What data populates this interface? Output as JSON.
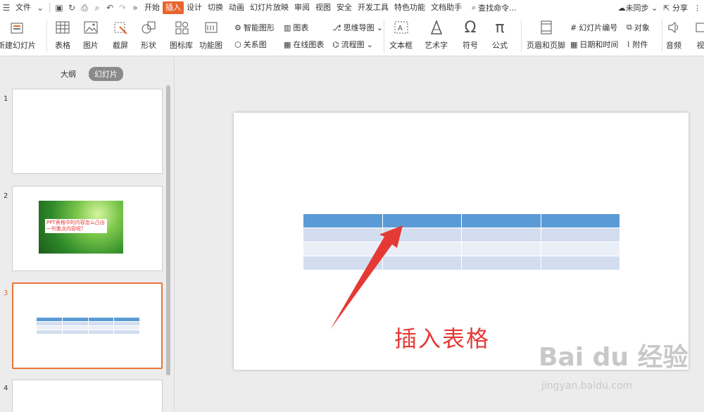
{
  "menubar": {
    "file": "文件",
    "tabs": [
      "开始",
      "插入",
      "设计",
      "切换",
      "动画",
      "幻灯片放映",
      "审阅",
      "视图",
      "安全",
      "开发工具",
      "特色功能",
      "文档助手"
    ],
    "active_tab_index": 1,
    "search": "查找命令...",
    "sync": "未同步",
    "share": "分享"
  },
  "ribbon": {
    "new_slide": "新建幻灯片",
    "table": "表格",
    "picture": "图片",
    "screenshot": "截屏",
    "shapes": "形状",
    "icon_lib": "图标库",
    "func_chart": "功能图",
    "smart_shape": "智能图形",
    "chart": "图表",
    "mind_map": "思维导图",
    "relation": "关系图",
    "online_chart": "在线图表",
    "flowchart": "流程图",
    "textbox": "文本框",
    "art_text": "艺术字",
    "symbol": "符号",
    "formula": "公式",
    "header_footer": "页眉和页脚",
    "slide_number": "幻灯片编号",
    "object": "对象",
    "date_time": "日期和时间",
    "attachment": "附件",
    "audio": "音频",
    "video": "视"
  },
  "panel": {
    "tab_outline": "大纲",
    "tab_slides": "幻灯片",
    "slides": [
      {
        "num": "1"
      },
      {
        "num": "2",
        "text": "PPT表格中的内容怎么凸出一列重点内容呢？"
      },
      {
        "num": "3"
      },
      {
        "num": "4"
      }
    ],
    "active_slide_index": 2
  },
  "annotation": {
    "caption": "插入表格"
  },
  "watermark": {
    "logo": "Bai  du 经验",
    "url": "jingyan.baidu.com"
  },
  "colors": {
    "accent": "#e8642c",
    "table_header": "#5b9bd5",
    "table_row_a": "#d2deef",
    "table_row_b": "#eaeff7",
    "arrow": "#e53935"
  }
}
